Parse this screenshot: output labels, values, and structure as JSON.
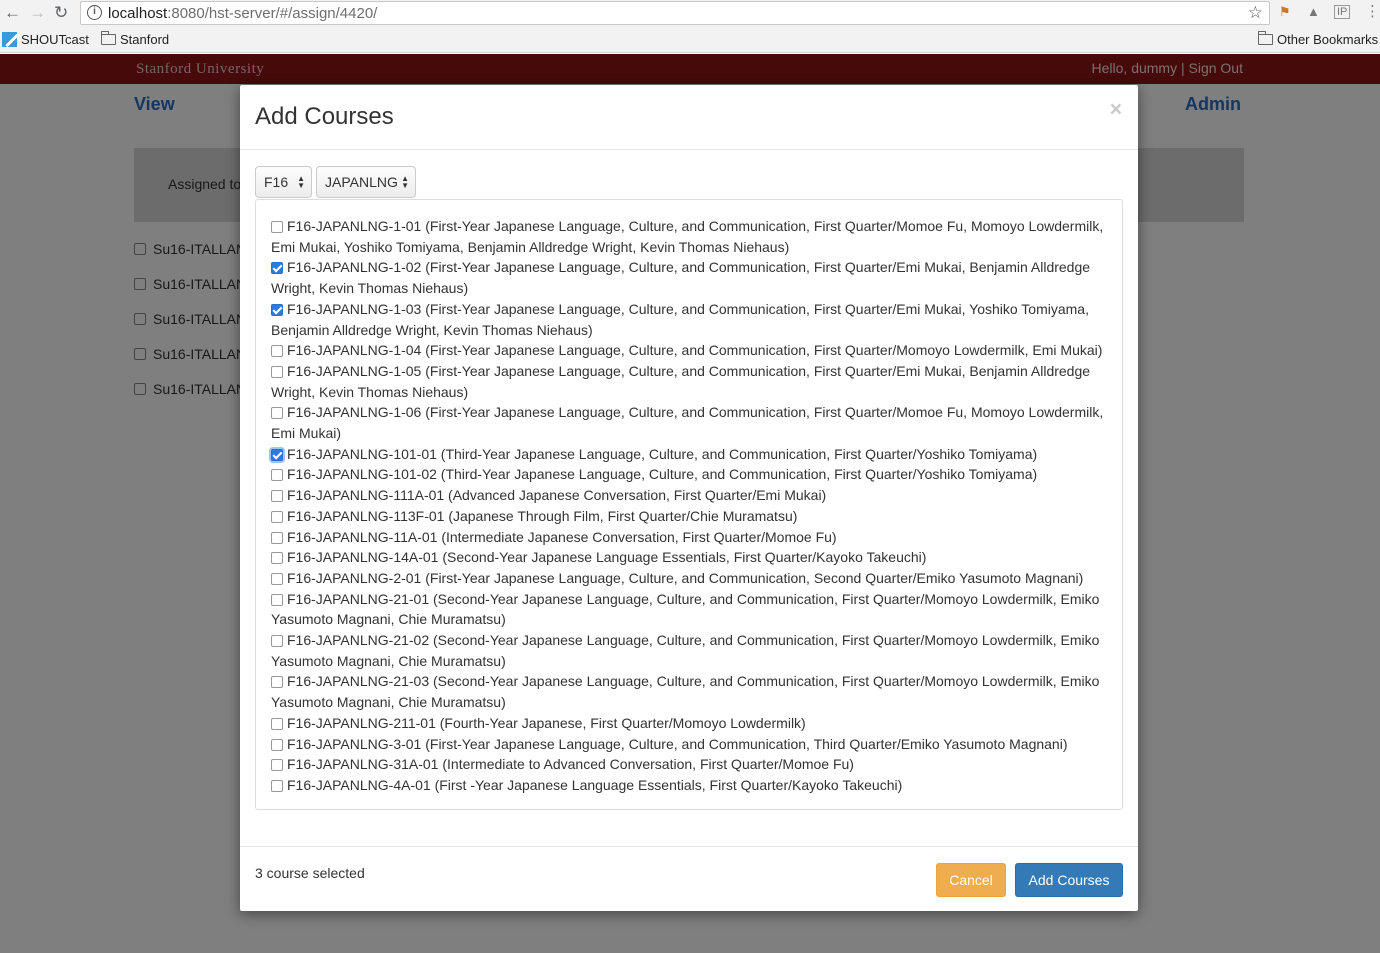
{
  "browser": {
    "url_host": "localhost",
    "url_rest": ":8080/hst-server/#/assign/4420/",
    "bookmarks": [
      "SHOUTcast",
      "Stanford"
    ],
    "other_bookmarks": "Other Bookmarks"
  },
  "header": {
    "brand": "Stanford University",
    "greeting": "Hello, dummy | Sign Out"
  },
  "nav": {
    "view": "View",
    "admin": "Admin"
  },
  "panel": {
    "label": "Assigned to"
  },
  "background_rows": [
    "Su16-ITALLAN",
    "Su16-ITALLAN",
    "Su16-ITALLAN",
    "Su16-ITALLAN",
    "Su16-ITALLAN"
  ],
  "modal": {
    "title": "Add Courses",
    "close": "×",
    "term_select": "F16",
    "subject_select": "JAPANLNG",
    "courses": [
      {
        "label": "F16-JAPANLNG-1-01 (First-Year Japanese Language, Culture, and Communication, First Quarter/Momoe Fu, Momoyo Lowdermilk, Emi Mukai, Yoshiko Tomiyama, Benjamin Alldredge Wright, Kevin Thomas Niehaus)",
        "checked": false
      },
      {
        "label": "F16-JAPANLNG-1-02 (First-Year Japanese Language, Culture, and Communication, First Quarter/Emi Mukai, Benjamin Alldredge Wright, Kevin Thomas Niehaus)",
        "checked": true
      },
      {
        "label": "F16-JAPANLNG-1-03 (First-Year Japanese Language, Culture, and Communication, First Quarter/Emi Mukai, Yoshiko Tomiyama, Benjamin Alldredge Wright, Kevin Thomas Niehaus)",
        "checked": true
      },
      {
        "label": "F16-JAPANLNG-1-04 (First-Year Japanese Language, Culture, and Communication, First Quarter/Momoyo Lowdermilk, Emi Mukai)",
        "checked": false
      },
      {
        "label": "F16-JAPANLNG-1-05 (First-Year Japanese Language, Culture, and Communication, First Quarter/Emi Mukai, Benjamin Alldredge Wright, Kevin Thomas Niehaus)",
        "checked": false
      },
      {
        "label": "F16-JAPANLNG-1-06 (First-Year Japanese Language, Culture, and Communication, First Quarter/Momoe Fu, Momoyo Lowdermilk, Emi Mukai)",
        "checked": false
      },
      {
        "label": "F16-JAPANLNG-101-01 (Third-Year Japanese Language, Culture, and Communication, First Quarter/Yoshiko Tomiyama)",
        "checked": true,
        "focused": true
      },
      {
        "label": "F16-JAPANLNG-101-02 (Third-Year Japanese Language, Culture, and Communication, First Quarter/Yoshiko Tomiyama)",
        "checked": false
      },
      {
        "label": "F16-JAPANLNG-111A-01 (Advanced Japanese Conversation, First Quarter/Emi Mukai)",
        "checked": false
      },
      {
        "label": "F16-JAPANLNG-113F-01 (Japanese Through Film, First Quarter/Chie Muramatsu)",
        "checked": false
      },
      {
        "label": "F16-JAPANLNG-11A-01 (Intermediate Japanese Conversation, First Quarter/Momoe Fu)",
        "checked": false
      },
      {
        "label": "F16-JAPANLNG-14A-01 (Second-Year Japanese Language Essentials, First Quarter/Kayoko Takeuchi)",
        "checked": false
      },
      {
        "label": "F16-JAPANLNG-2-01 (First-Year Japanese Language, Culture, and Communication, Second Quarter/Emiko Yasumoto Magnani)",
        "checked": false
      },
      {
        "label": "F16-JAPANLNG-21-01 (Second-Year Japanese Language, Culture, and Communication, First Quarter/Momoyo Lowdermilk, Emiko Yasumoto Magnani, Chie Muramatsu)",
        "checked": false
      },
      {
        "label": "F16-JAPANLNG-21-02 (Second-Year Japanese Language, Culture, and Communication, First Quarter/Momoyo Lowdermilk, Emiko Yasumoto Magnani, Chie Muramatsu)",
        "checked": false
      },
      {
        "label": "F16-JAPANLNG-21-03 (Second-Year Japanese Language, Culture, and Communication, First Quarter/Momoyo Lowdermilk, Emiko Yasumoto Magnani, Chie Muramatsu)",
        "checked": false
      },
      {
        "label": "F16-JAPANLNG-211-01 (Fourth-Year Japanese, First Quarter/Momoyo Lowdermilk)",
        "checked": false
      },
      {
        "label": "F16-JAPANLNG-3-01 (First-Year Japanese Language, Culture, and Communication, Third Quarter/Emiko Yasumoto Magnani)",
        "checked": false
      },
      {
        "label": "F16-JAPANLNG-31A-01 (Intermediate to Advanced Conversation, First Quarter/Momoe Fu)",
        "checked": false
      },
      {
        "label": "F16-JAPANLNG-4A-01 (First -Year Japanese Language Essentials, First Quarter/Kayoko Takeuchi)",
        "checked": false
      }
    ],
    "selected_count_text": "3 course selected",
    "cancel_label": "Cancel",
    "add_label": "Add Courses"
  },
  "colors": {
    "cardinal": "#8c1515",
    "primary": "#337ab7",
    "warning": "#f0ad4e",
    "link": "#2a6ebb"
  }
}
